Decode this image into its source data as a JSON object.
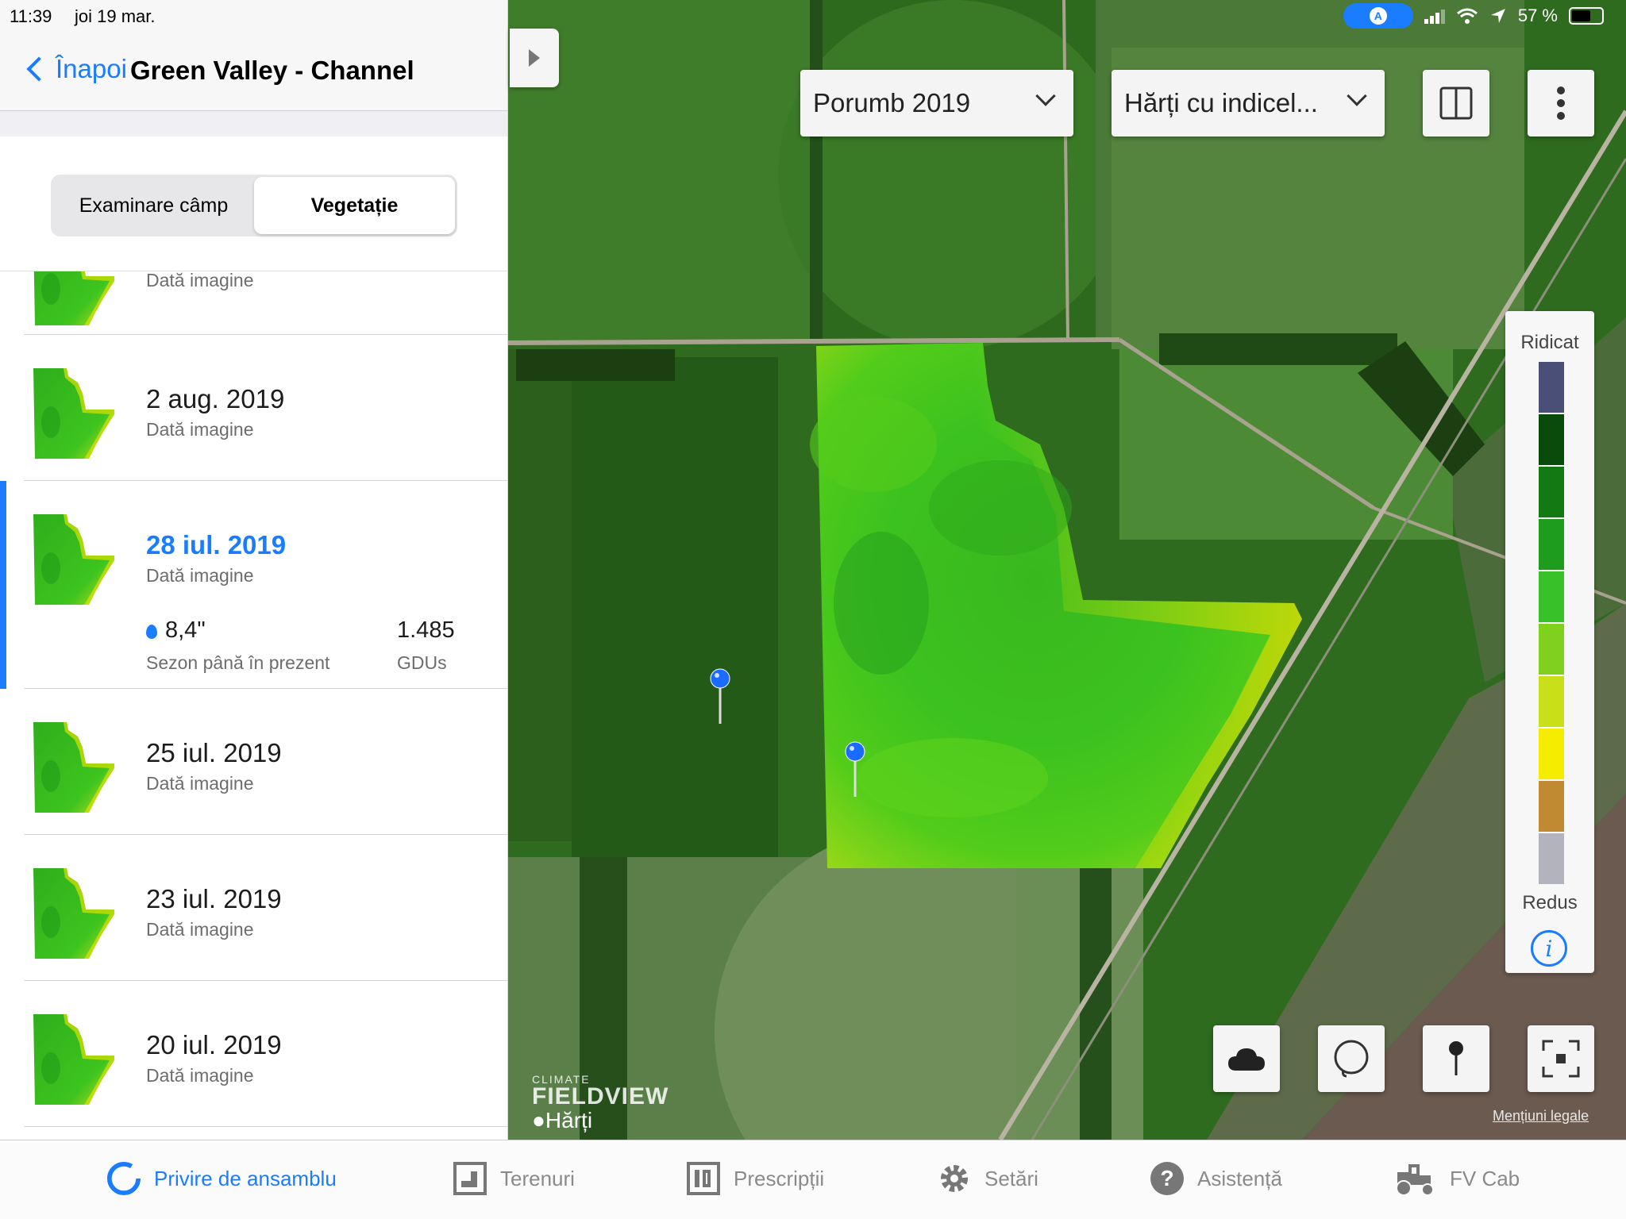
{
  "status_bar": {
    "time": "11:39",
    "date": "joi 19 mar.",
    "battery": "57 %",
    "nav_badge": "A"
  },
  "header": {
    "back_label": "Înapoi",
    "title": "Green Valley - Channel"
  },
  "segmented": {
    "options": [
      "Examinare câmp",
      "Vegetație"
    ],
    "selected": "Vegetație"
  },
  "image_list": {
    "items": [
      {
        "date": "",
        "subtitle": "Dată imagine"
      },
      {
        "date": "2 aug. 2019",
        "subtitle": "Dată imagine"
      },
      {
        "date": "28 iul. 2019",
        "subtitle": "Dată imagine",
        "selected": true,
        "rain_value": "8,4\"",
        "rain_label": "Sezon până în prezent",
        "gdu_value": "1.485",
        "gdu_label": "GDUs"
      },
      {
        "date": "25 iul. 2019",
        "subtitle": "Dată imagine"
      },
      {
        "date": "23 iul. 2019",
        "subtitle": "Dată imagine"
      },
      {
        "date": "20 iul. 2019",
        "subtitle": "Dată imagine"
      }
    ]
  },
  "map": {
    "season_dropdown": "Porumb 2019",
    "layer_dropdown": "Hărți cu indicel...",
    "icons": {
      "split_view": "split-view-icon",
      "more": "more-icon",
      "cloud": "cloud-icon",
      "lasso": "lasso-icon",
      "pin": "pin-icon",
      "fullscreen": "fullscreen-icon"
    },
    "legend": {
      "high_label": "Ridicat",
      "low_label": "Redus",
      "colors": [
        "#4a4f78",
        "#0a4a0a",
        "#137a13",
        "#1e9c1e",
        "#39c12a",
        "#7fd11e",
        "#c8e01a",
        "#f5ec00",
        "#bf8a32",
        "#b3b3bd"
      ]
    },
    "watermark_small": "CLIMATE",
    "watermark_big": "FIELDVIEW",
    "maps_label": "Hărți",
    "legal_label": "Mențiuni legale"
  },
  "tab_bar": {
    "tabs": [
      {
        "label": "Privire de ansamblu",
        "icon": "overview-ring-icon",
        "active": true
      },
      {
        "label": "Terenuri",
        "icon": "fields-icon"
      },
      {
        "label": "Prescripții",
        "icon": "prescriptions-icon"
      },
      {
        "label": "Setări",
        "icon": "gear-icon"
      },
      {
        "label": "Asistență",
        "icon": "help-icon"
      },
      {
        "label": "FV Cab",
        "icon": "tractor-icon"
      }
    ]
  }
}
